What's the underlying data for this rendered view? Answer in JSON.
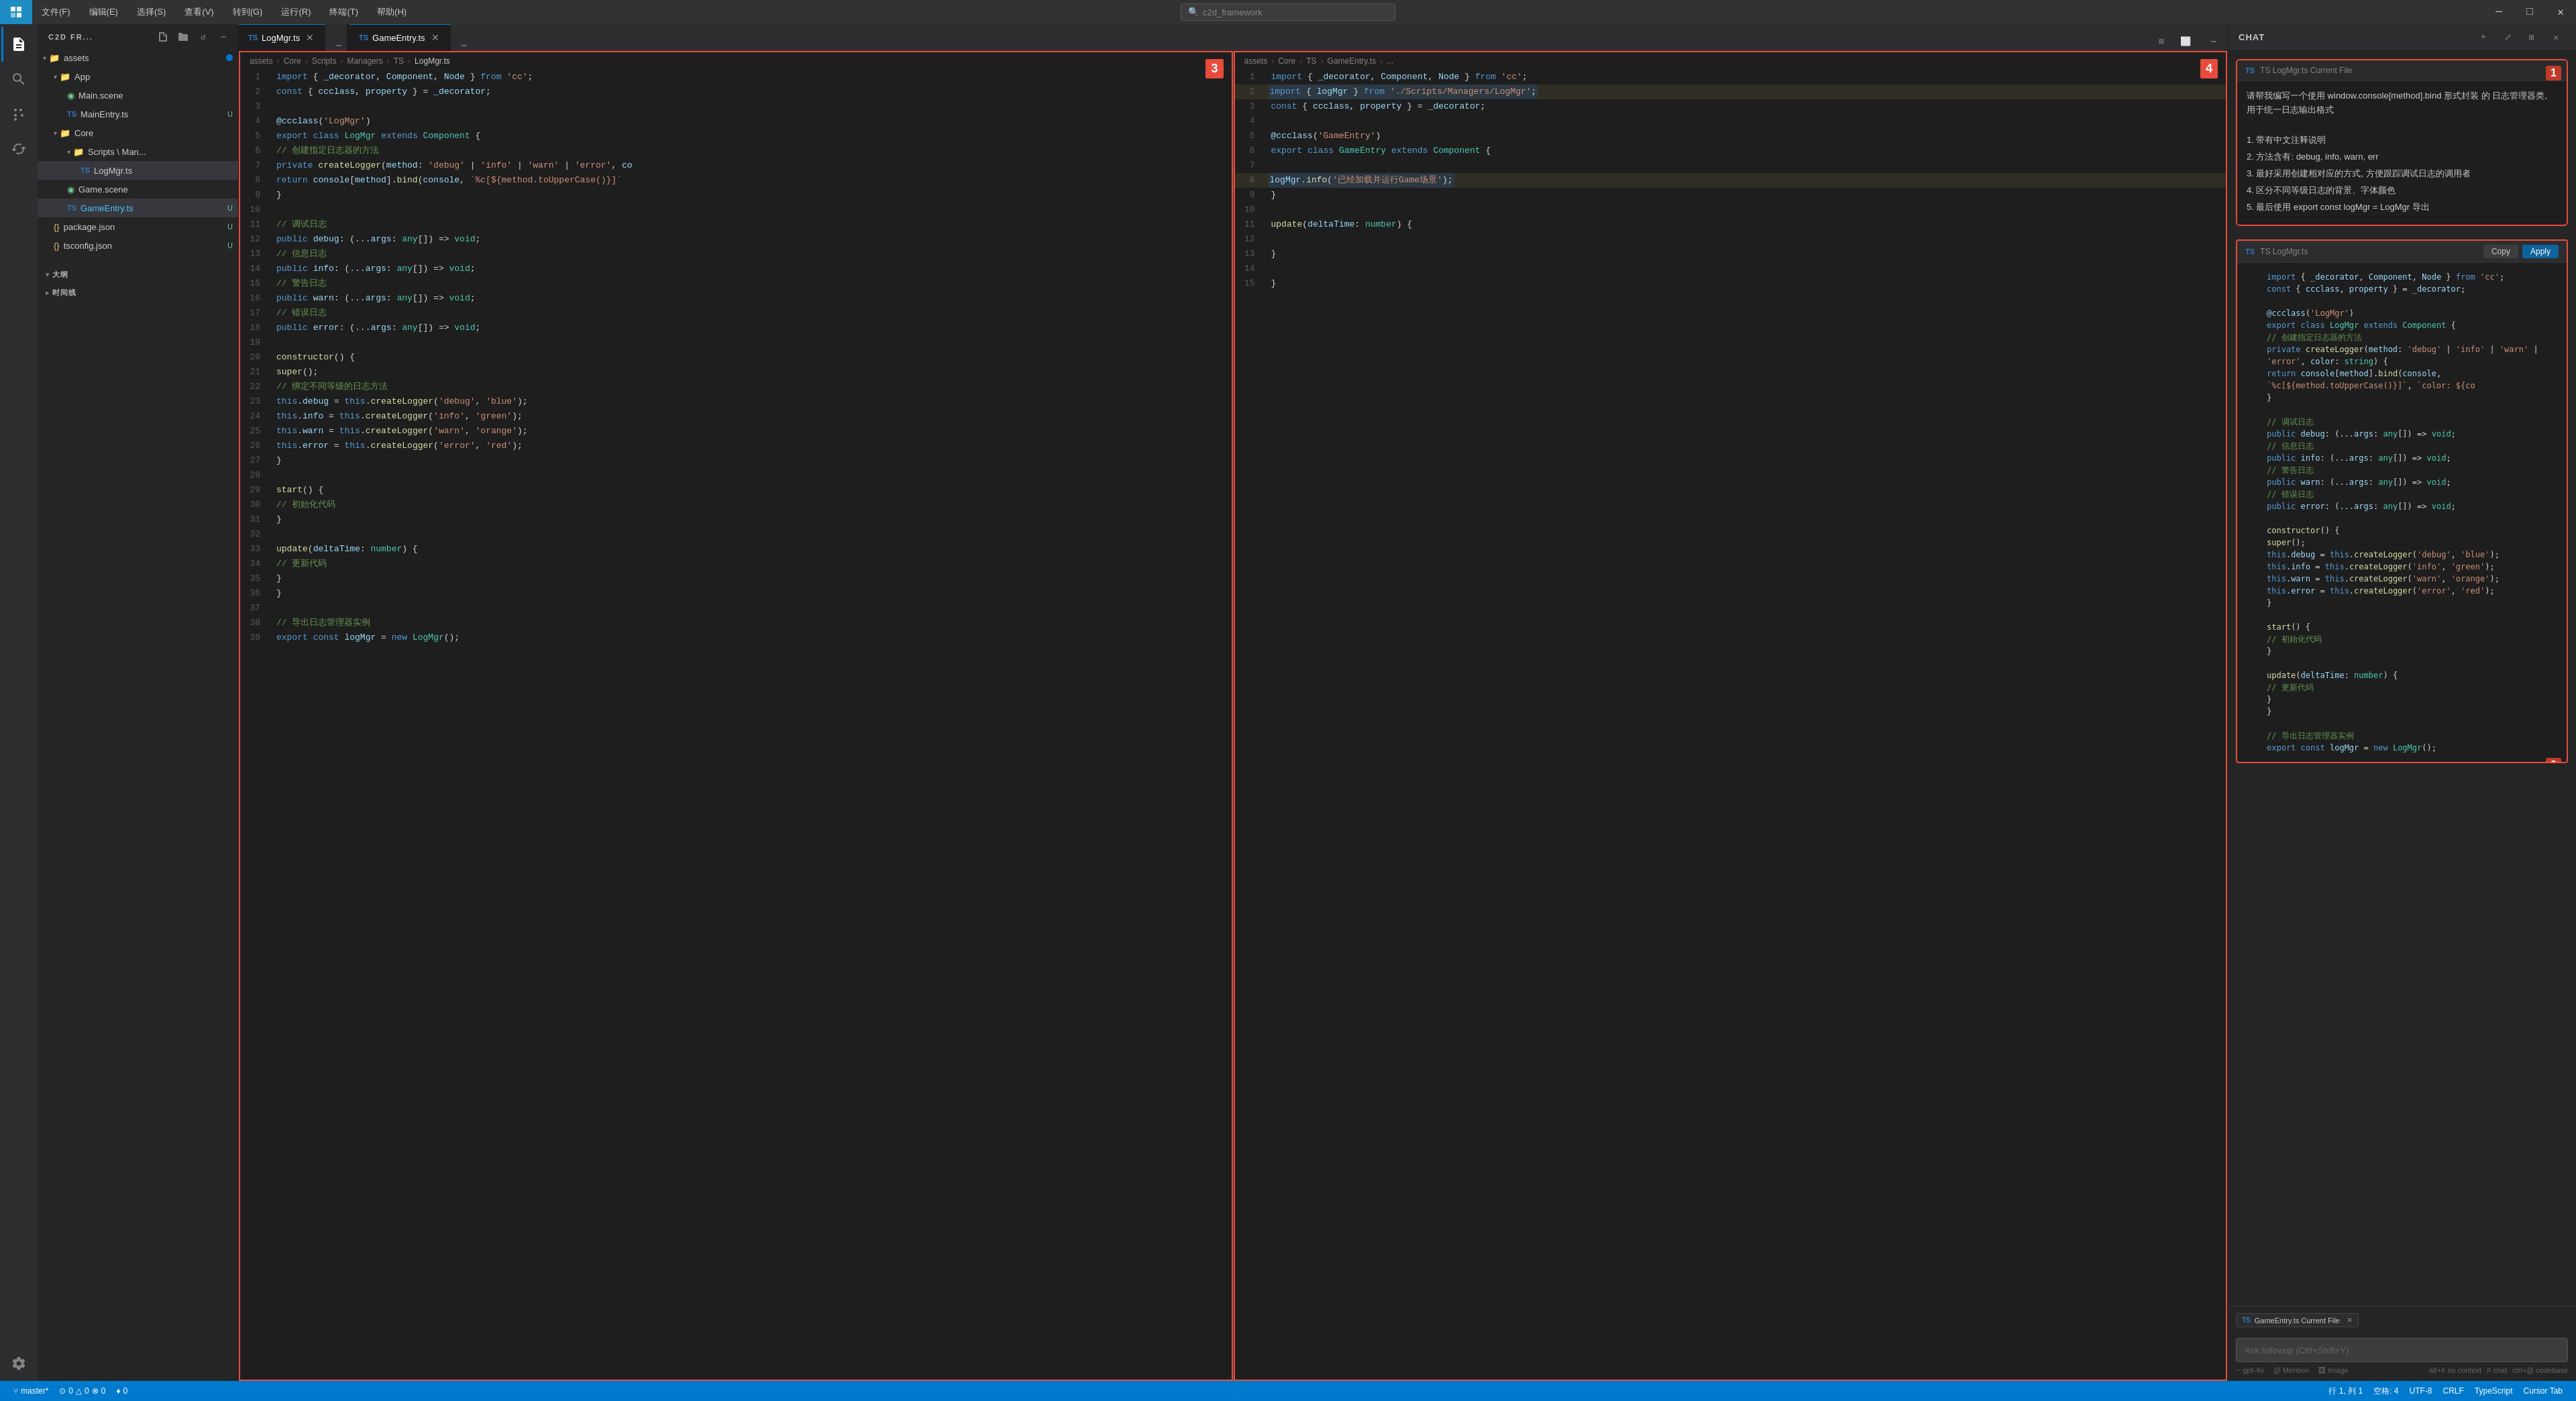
{
  "titleBar": {
    "icon": "◆",
    "menus": [
      "文件(F)",
      "编辑(E)",
      "选择(S)",
      "查看(V)",
      "转到(G)",
      "运行(R)",
      "终端(T)",
      "帮助(H)"
    ],
    "search": {
      "placeholder": "c2d_framework",
      "icon": "🔍"
    },
    "windowButtons": [
      "─",
      "□",
      "✕"
    ]
  },
  "activityBar": {
    "icons": [
      "📋",
      "🔍",
      "⑂",
      "🐛",
      "🧩"
    ]
  },
  "sidebar": {
    "title": "C2D FR...",
    "actions": [
      "+",
      "□+",
      "↺",
      "⋯"
    ],
    "tree": [
      {
        "label": "assets",
        "type": "folder",
        "indent": 0,
        "open": true,
        "badge": "dot"
      },
      {
        "label": "App",
        "type": "folder",
        "indent": 1,
        "open": true,
        "badge": null
      },
      {
        "label": "Main.scene",
        "type": "file",
        "indent": 2,
        "badge": null,
        "ext": "scene"
      },
      {
        "label": "MainEntry.ts",
        "type": "file",
        "indent": 2,
        "badge": "U",
        "ext": "ts"
      },
      {
        "label": "Core",
        "type": "folder",
        "indent": 1,
        "open": true,
        "badge": null
      },
      {
        "label": "Scripts \\ Man...",
        "type": "folder",
        "indent": 2,
        "open": true,
        "badge": null
      },
      {
        "label": "LogMgr.ts",
        "type": "file",
        "indent": 3,
        "badge": null,
        "ext": "ts",
        "active": true
      },
      {
        "label": "Game.scene",
        "type": "file",
        "indent": 2,
        "badge": null,
        "ext": "scene"
      },
      {
        "label": "GameEntry.ts",
        "type": "file",
        "indent": 2,
        "badge": "U",
        "ext": "ts",
        "highlighted": true
      },
      {
        "label": "package.json",
        "type": "file",
        "indent": 1,
        "badge": "U",
        "ext": "json"
      },
      {
        "label": "tsconfig.json",
        "type": "file",
        "indent": 1,
        "badge": "U",
        "ext": "json"
      }
    ]
  },
  "editorLeft": {
    "tab": {
      "label": "LogMgr.ts",
      "dirty": false,
      "active": true
    },
    "breadcrumb": [
      "assets",
      "Core",
      "Scripts",
      "Managers",
      "TS",
      "LogMgr.ts"
    ],
    "lines": [
      {
        "n": 1,
        "code": "import { _decorator, Component, Node } from 'cc';"
      },
      {
        "n": 2,
        "code": "const { ccclass, property } = _decorator;"
      },
      {
        "n": 3,
        "code": ""
      },
      {
        "n": 4,
        "code": "@ccclass('LogMgr')"
      },
      {
        "n": 5,
        "code": "export class LogMgr extends Component {"
      },
      {
        "n": 6,
        "code": "    // 创建指定日志器的方法"
      },
      {
        "n": 7,
        "code": "    private createLogger(method: 'debug' | 'info' | 'warn' | 'error', co"
      },
      {
        "n": 8,
        "code": "        return console[method].bind(console, `%c[${method.toUpperCase()}]`"
      },
      {
        "n": 9,
        "code": "    }"
      },
      {
        "n": 10,
        "code": ""
      },
      {
        "n": 11,
        "code": "    // 调试日志"
      },
      {
        "n": 12,
        "code": "    public debug: (...args: any[]) => void;"
      },
      {
        "n": 13,
        "code": "    // 信息日志"
      },
      {
        "n": 14,
        "code": "    public info: (...args: any[]) => void;"
      },
      {
        "n": 15,
        "code": "    // 警告日志"
      },
      {
        "n": 16,
        "code": "    public warn: (...args: any[]) => void;"
      },
      {
        "n": 17,
        "code": "    // 错误日志"
      },
      {
        "n": 18,
        "code": "    public error: (...args: any[]) => void;"
      },
      {
        "n": 19,
        "code": ""
      },
      {
        "n": 20,
        "code": "    constructor() {"
      },
      {
        "n": 21,
        "code": "        super();"
      },
      {
        "n": 22,
        "code": "        // 绑定不同等级的日志方法"
      },
      {
        "n": 23,
        "code": "        this.debug = this.createLogger('debug', 'blue');"
      },
      {
        "n": 24,
        "code": "        this.info = this.createLogger('info', 'green');"
      },
      {
        "n": 25,
        "code": "        this.warn = this.createLogger('warn', 'orange');"
      },
      {
        "n": 26,
        "code": "        this.error = this.createLogger('error', 'red');"
      },
      {
        "n": 27,
        "code": "    }"
      },
      {
        "n": 28,
        "code": ""
      },
      {
        "n": 29,
        "code": "    start() {"
      },
      {
        "n": 30,
        "code": "        // 初始化代码"
      },
      {
        "n": 31,
        "code": "    }"
      },
      {
        "n": 32,
        "code": ""
      },
      {
        "n": 33,
        "code": "    update(deltaTime: number) {"
      },
      {
        "n": 34,
        "code": "        // 更新代码"
      },
      {
        "n": 35,
        "code": "    }"
      },
      {
        "n": 36,
        "code": "}"
      },
      {
        "n": 37,
        "code": ""
      },
      {
        "n": 38,
        "code": "    // 导出日志管理器实例"
      },
      {
        "n": 39,
        "code": "export const logMgr = new LogMgr();"
      }
    ],
    "badgeNumber": "3"
  },
  "editorRight": {
    "tab": {
      "label": "GameEntry.ts",
      "dirty": false,
      "active": true
    },
    "breadcrumb": [
      "assets",
      "Core",
      "TS",
      "GameEntry.ts",
      "..."
    ],
    "lines": [
      {
        "n": 1,
        "code": "import { _decorator, Component, Node } from 'cc';"
      },
      {
        "n": 2,
        "code": "import { logMgr } from './Scripts/Managers/LogMgr';",
        "highlight": true
      },
      {
        "n": 3,
        "code": "const { ccclass, property } = _decorator;"
      },
      {
        "n": 4,
        "code": ""
      },
      {
        "n": 5,
        "code": "@ccclass('GameEntry')"
      },
      {
        "n": 6,
        "code": "export class GameEntry extends Component {"
      },
      {
        "n": 7,
        "code": ""
      },
      {
        "n": 8,
        "code": "        logMgr.info('已经加载并运行Game场景');",
        "highlight2": true
      },
      {
        "n": 9,
        "code": "    }"
      },
      {
        "n": 10,
        "code": ""
      },
      {
        "n": 11,
        "code": "    update(deltaTime: number) {"
      },
      {
        "n": 12,
        "code": ""
      },
      {
        "n": 13,
        "code": "    }"
      },
      {
        "n": 14,
        "code": ""
      },
      {
        "n": 15,
        "code": "}"
      }
    ],
    "badgeNumber": "4"
  },
  "chatPanel": {
    "title": "CHAT",
    "headerButtons": [
      "+",
      "⤢",
      "⊞",
      "✕"
    ],
    "aiMessageHeader": "TS LogMgr.ts Current File",
    "aiMessage": {
      "intro": "请帮我编写一个使用 window.console[method].bind 形式封装 的 日志管理器类, 用于统一日志输出格式",
      "items": [
        "1. 带有中文注释说明",
        "2. 方法含有: debug, info, warn, err",
        "3. 最好采用创建相对应的方式, 方便跟踪调试日志的调用者",
        "4. 区分不同等级日志的背景、字体颜色",
        "5. 最后使用 export const logMgr = LogMgr 导出"
      ]
    },
    "codeBlockHeader": "TS LogMgr.ts",
    "copyLabel": "Copy",
    "applyLabel": "Apply",
    "codeLines": [
      "import { _decorator, Component, Node } from 'cc';",
      "const { ccclass, property } = _decorator;",
      "",
      "@ccclass('LogMgr')",
      "export class LogMgr extends Component {",
      "    // 创建指定日志器的方法",
      "    private createLogger(method: 'debug' | 'info' | 'warn' | 'error', color: string) {",
      "        return console[method].bind(console, `%c[${method.toUpperCase()}]`, `color: ${co",
      "    }",
      "",
      "    // 调试日志",
      "    public debug: (...args: any[]) => void;",
      "    // 信息日志",
      "    public info: (...args: any[]) => void;",
      "    // 警告日志",
      "    public warn: (...args: any[]) => void;",
      "    // 错误日志",
      "    public error: (...args: any[]) => void;",
      "",
      "    constructor() {",
      "        super();",
      "        this.debug = this.createLogger('debug', 'blue');",
      "        this.info = this.createLogger('info', 'green');",
      "        this.warn = this.createLogger('warn', 'orange');",
      "        this.error = this.createLogger('error', 'red');",
      "    }",
      "",
      "    start() {",
      "        // 初始化代码",
      "    }",
      "",
      "    update(deltaTime: number) {",
      "        // 更新代码",
      "    }",
      "}",
      "",
      "// 导出日志管理器实例",
      "export const logMgr = new LogMgr();"
    ],
    "badgeNumber": "2",
    "inputArea": {
      "fileBadge": "TS GameEntry.ts Current File ✕",
      "placeholder": "Ask followup (Ctrl+Shift+Y)",
      "model": "gpt-4o",
      "mention": "@ Mention",
      "image": "🖼 Image",
      "rightHints": [
        "alt+# no context",
        "# chat",
        "ctrl+@ codebase"
      ]
    }
  },
  "statusBar": {
    "left": [
      {
        "label": "⑂ master*",
        "icon": "git"
      },
      {
        "label": "⊙ 0 △ 0 ⊗ 0",
        "icon": "errors"
      },
      {
        "label": "♦ 0",
        "icon": "warnings"
      }
    ],
    "right": [
      {
        "label": "行 1, 列 1"
      },
      {
        "label": "空格: 4"
      },
      {
        "label": "UTF-8"
      },
      {
        "label": "CRLF"
      },
      {
        "label": "TypeScript"
      },
      {
        "label": "Cursor Tab"
      }
    ]
  }
}
